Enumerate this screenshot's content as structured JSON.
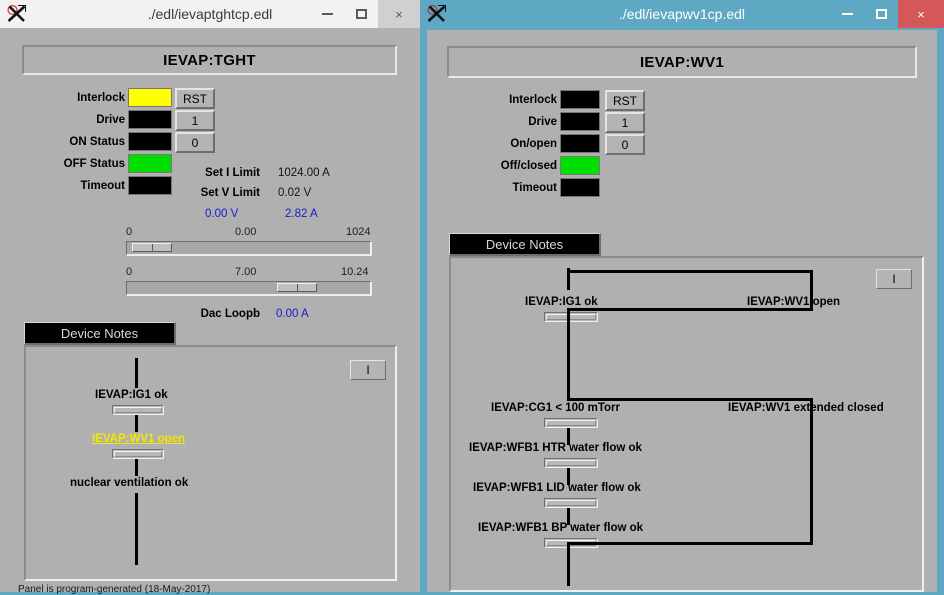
{
  "desktop": {
    "background_color": "#5fa8c4"
  },
  "left_window": {
    "title": "./edl/ievaptghtcp.edl",
    "state": "inactive",
    "icon": "x-logo-icon",
    "controls": {
      "minimize": "–",
      "maximize": "❑",
      "close": "×"
    },
    "header": "IEVAP:TGHT",
    "status_rows": [
      {
        "label": "Interlock",
        "color": "#ffff00"
      },
      {
        "label": "Drive",
        "color": "#000000"
      },
      {
        "label": "ON Status",
        "color": "#000000"
      },
      {
        "label": "OFF Status",
        "color": "#00e000"
      },
      {
        "label": "Timeout",
        "color": "#000000"
      }
    ],
    "buttons": [
      {
        "name": "reset-button",
        "label": "RST"
      },
      {
        "name": "drive-on-button",
        "label": "1"
      },
      {
        "name": "drive-off-button",
        "label": "0"
      }
    ],
    "readouts": [
      {
        "label": "Set I Limit",
        "value": "1024.00 A"
      },
      {
        "label": "Set V Limit",
        "value": "0.02 V"
      }
    ],
    "live_values": [
      {
        "value": "0.00 V",
        "color": "#1a1ad0"
      },
      {
        "value": "2.82 A",
        "color": "#1a1ad0"
      }
    ],
    "sliders": [
      {
        "name": "current-slider",
        "min": "0",
        "value": "0.00",
        "max": "1024",
        "fraction": 0.02
      },
      {
        "name": "voltage-slider",
        "min": "0",
        "value": "7.00",
        "max": "10.24",
        "fraction": 0.68
      }
    ],
    "dac": {
      "label": "Dac Loopb",
      "value": "0.00 A"
    },
    "notes_tab": "Device Notes",
    "notes_toggle_button": "I",
    "notes_items": [
      {
        "label": "IEVAP:IG1 ok",
        "highlight": false
      },
      {
        "label": "IEVAP:WV1 open",
        "highlight": true
      },
      {
        "label": "nuclear ventilation ok",
        "highlight": false
      }
    ],
    "footer": "Panel is program-generated (18-May-2017)"
  },
  "right_window": {
    "title": "./edl/ievapwv1cp.edl",
    "state": "active",
    "icon": "x-logo-icon",
    "controls": {
      "minimize": "–",
      "maximize": "❑",
      "close": "×"
    },
    "header": "IEVAP:WV1",
    "status_rows": [
      {
        "label": "Interlock",
        "color": "#000000"
      },
      {
        "label": "Drive",
        "color": "#000000"
      },
      {
        "label": "On/open",
        "color": "#000000"
      },
      {
        "label": "Off/closed",
        "color": "#00e000"
      },
      {
        "label": "Timeout",
        "color": "#000000"
      }
    ],
    "buttons": [
      {
        "name": "reset-button",
        "label": "RST"
      },
      {
        "name": "drive-on-button",
        "label": "1"
      },
      {
        "name": "drive-off-button",
        "label": "0"
      }
    ],
    "notes_tab": "Device Notes",
    "notes_toggle_button": "I",
    "notes_items": [
      {
        "label": "IEVAP:IG1 ok"
      },
      {
        "label": "IEVAP:WV1 open"
      },
      {
        "label": "IEVAP:CG1 < 100 mTorr"
      },
      {
        "label": "IEVAP:WV1 extended closed"
      },
      {
        "label": "IEVAP:WFB1 HTR water flow ok"
      },
      {
        "label": "IEVAP:WFB1 LID water flow ok"
      },
      {
        "label": "IEVAP:WFB1 BP water flow ok"
      }
    ]
  }
}
